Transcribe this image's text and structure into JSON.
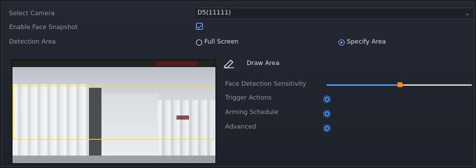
{
  "form": {
    "select_camera_label": "Select Camera",
    "camera_value": "D5(11111)",
    "enable_face_snapshot_label": "Enable Face Snapshot",
    "enable_face_snapshot_checked": true,
    "detection_area_label": "Detection Area",
    "full_screen_label": "Full Screen",
    "specify_area_label": "Specify Area",
    "selected_area_mode": "Specify Area"
  },
  "panel": {
    "draw_area_label": "Draw Area",
    "face_detection_sensitivity_label": "Face Detection Sensitivity",
    "sensitivity_fraction": 0.5,
    "trigger_actions_label": "Trigger Actions",
    "arming_schedule_label": "Arming Schedule",
    "advanced_label": "Advanced"
  },
  "icons": {
    "dropdown": "chevron-down-icon",
    "draw": "pen-icon",
    "settings": "gear-icon"
  },
  "colors": {
    "accent": "#4aa1ff",
    "thumb": "#ff8a1f",
    "zone": "#f0e23a",
    "gear": "#3f86e8"
  }
}
